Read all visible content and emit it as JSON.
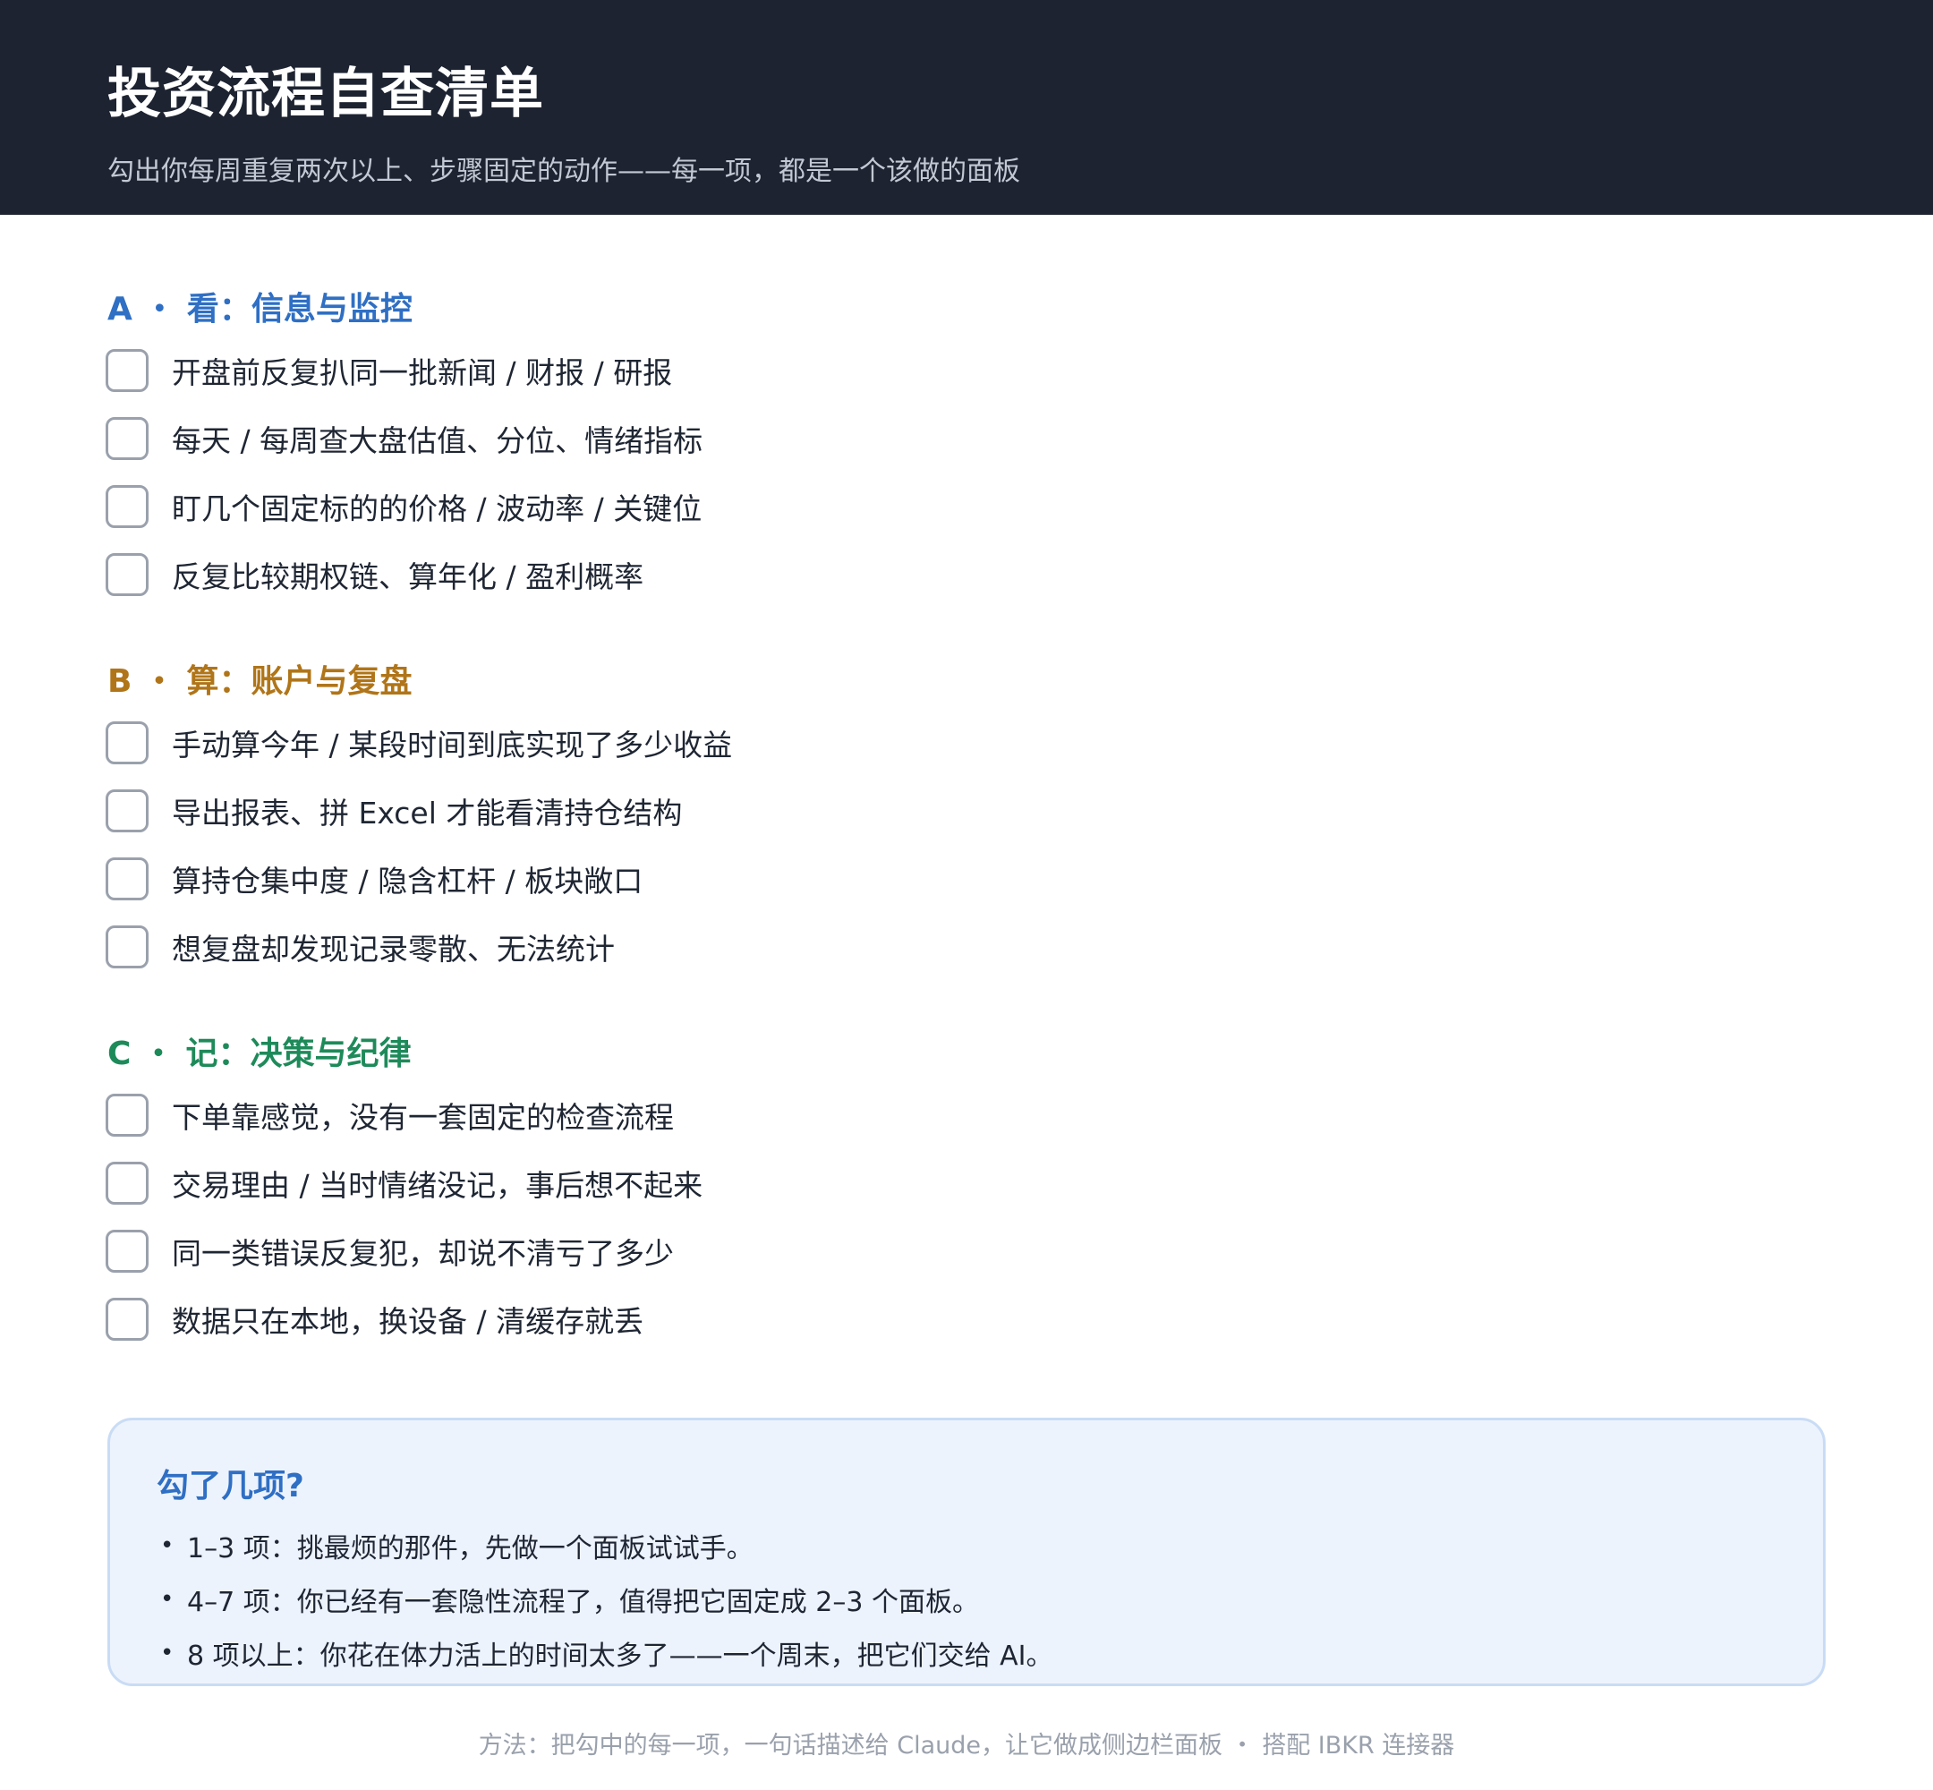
{
  "header": {
    "title": "投资流程自查清单",
    "subtitle": "勾出你每周重复两次以上、步骤固定的动作——每一项，都是一个该做的面板"
  },
  "sections": [
    {
      "heading": "A ・ 看：信息与监控",
      "color": "#2f6fc4",
      "items": [
        {
          "label": "开盘前反复扒同一批新闻 / 财报 / 研报",
          "checked": false
        },
        {
          "label": "每天 / 每周查大盘估值、分位、情绪指标",
          "checked": false
        },
        {
          "label": "盯几个固定标的的价格 / 波动率 / 关键位",
          "checked": false
        },
        {
          "label": "反复比较期权链、算年化 / 盈利概率",
          "checked": false
        }
      ]
    },
    {
      "heading": "B ・ 算：账户与复盘",
      "color": "#b07519",
      "items": [
        {
          "label": "手动算今年 / 某段时间到底实现了多少收益",
          "checked": false
        },
        {
          "label": "导出报表、拼 Excel 才能看清持仓结构",
          "checked": false
        },
        {
          "label": "算持仓集中度 / 隐含杠杆 / 板块敞口",
          "checked": false
        },
        {
          "label": "想复盘却发现记录零散、无法统计",
          "checked": false
        }
      ]
    },
    {
      "heading": "C ・ 记：决策与纪律",
      "color": "#1e8a5a",
      "items": [
        {
          "label": "下单靠感觉，没有一套固定的检查流程",
          "checked": false
        },
        {
          "label": "交易理由 / 当时情绪没记，事后想不起来",
          "checked": false
        },
        {
          "label": "同一类错误反复犯，却说不清亏了多少",
          "checked": false
        },
        {
          "label": "数据只在本地，换设备 / 清缓存就丢",
          "checked": false
        }
      ]
    }
  ],
  "summary": {
    "title": "勾了几项?",
    "bullet": "•",
    "lines": [
      "1–3 项：挑最烦的那件，先做一个面板试试手。",
      "4–7 项：你已经有一套隐性流程了，值得把它固定成 2–3 个面板。",
      "8 项以上：你花在体力活上的时间太多了——一个周末，把它们交给 AI。"
    ]
  },
  "footer": {
    "note": "方法：把勾中的每一项，一句话描述给 Claude，让它做成侧边栏面板 ・ 搭配 IBKR 连接器"
  }
}
